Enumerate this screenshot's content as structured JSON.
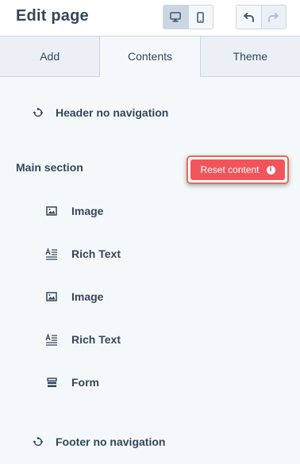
{
  "header": {
    "title": "Edit page",
    "device_buttons": [
      {
        "name": "desktop-view",
        "icon": "desktop-icon",
        "active": true
      },
      {
        "name": "mobile-view",
        "icon": "mobile-icon",
        "active": false
      }
    ],
    "history_buttons": [
      {
        "name": "undo",
        "icon": "undo-icon",
        "enabled": true
      },
      {
        "name": "redo",
        "icon": "redo-icon",
        "enabled": false
      }
    ]
  },
  "tabs": [
    {
      "label": "Add",
      "active": false
    },
    {
      "label": "Contents",
      "active": true
    },
    {
      "label": "Theme",
      "active": false
    }
  ],
  "contents": {
    "header_item": {
      "label": "Header no navigation",
      "icon": "global-module-icon"
    },
    "main_section": {
      "title": "Main section",
      "reset_label": "Reset content",
      "reset_icon": "info-icon",
      "items": [
        {
          "label": "Image",
          "icon": "image-icon"
        },
        {
          "label": "Rich Text",
          "icon": "rich-text-icon"
        },
        {
          "label": "Image",
          "icon": "image-icon"
        },
        {
          "label": "Rich Text",
          "icon": "rich-text-icon"
        },
        {
          "label": "Form",
          "icon": "form-icon"
        }
      ]
    },
    "footer_item": {
      "label": "Footer no navigation",
      "icon": "global-module-icon"
    }
  },
  "colors": {
    "primary_text": "#33475b",
    "reset_button": "#f2545b",
    "reset_highlight": "#e66e50",
    "panel_background": "#f5f8fa"
  }
}
